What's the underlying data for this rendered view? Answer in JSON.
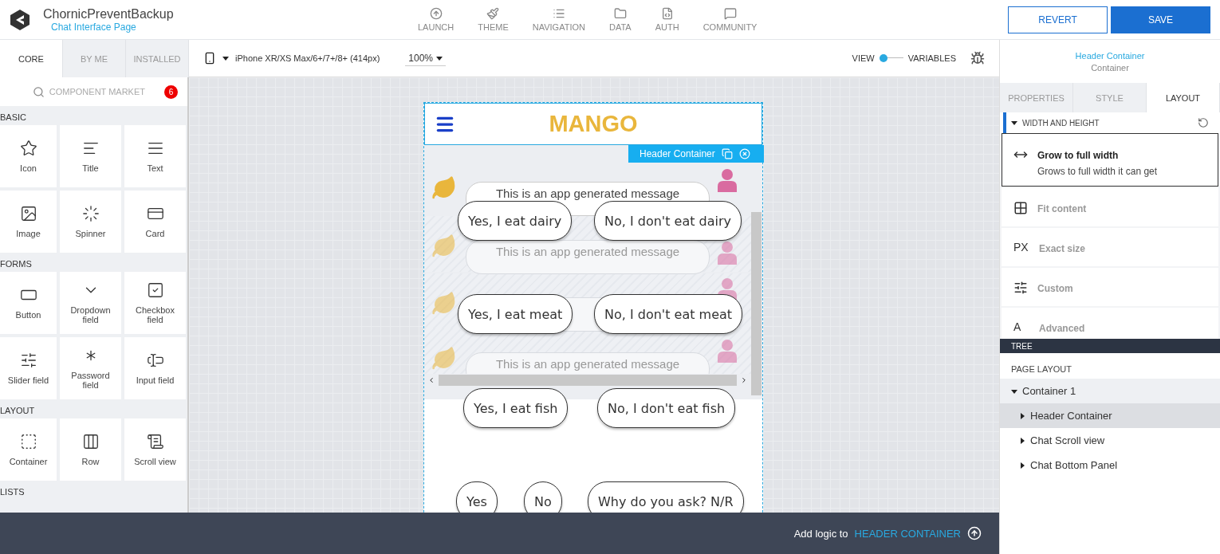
{
  "app": {
    "title": "ChornicPreventBackup",
    "page": "Chat Interface Page"
  },
  "nav": [
    "LAUNCH",
    "THEME",
    "NAVIGATION",
    "DATA",
    "AUTH",
    "COMMUNITY"
  ],
  "actions": [
    {
      "label": "REVERT",
      "kind": "outline"
    },
    {
      "label": "SAVE",
      "kind": "primary"
    }
  ],
  "component_tabs": [
    {
      "label": "CORE",
      "selected": true
    },
    {
      "label": "BY ME",
      "selected": false
    },
    {
      "label": "INSTALLED",
      "selected": false
    }
  ],
  "market": {
    "label": "COMPONENT MARKET",
    "badge": "6"
  },
  "component_groups": [
    {
      "title": "BASIC",
      "items": [
        "Icon",
        "Title",
        "Text",
        "Image",
        "Spinner",
        "Card"
      ]
    },
    {
      "title": "FORMS",
      "items": [
        "Button",
        "Dropdown field",
        "Checkbox field",
        "Slider field",
        "Password field",
        "Input field"
      ]
    },
    {
      "title": "LAYOUT",
      "items": [
        "Container",
        "Row",
        "Scroll view"
      ]
    },
    {
      "title": "LISTS"
    }
  ],
  "device": {
    "label": "iPhone XR/XS Max/6+/7+/8+ (414px)",
    "zoom": "100%"
  },
  "view_toggle": {
    "left": "VIEW",
    "right": "VARIABLES",
    "on": false
  },
  "preview": {
    "title": "MANGO",
    "selection_label": "Header Container",
    "messages": [
      "This is an app generated message",
      "This is an app generated message",
      "This is an app generated message"
    ],
    "choice_rows": [
      [
        "Yes, I eat dairy",
        "No, I don't eat dairy"
      ],
      [
        "Yes, I eat meat",
        "No, I don't eat meat"
      ],
      [
        "Yes, I eat fish",
        "No, I don't eat fish"
      ],
      [
        "Yes",
        "No",
        "Why do you ask? N/R"
      ]
    ]
  },
  "logic_bar": {
    "label": "Add logic to",
    "target": "HEADER CONTAINER"
  },
  "inspector": {
    "name": "Header Container",
    "type": "Container",
    "tabs": [
      {
        "label": "PROPERTIES",
        "selected": false
      },
      {
        "label": "STYLE",
        "selected": false
      },
      {
        "label": "LAYOUT",
        "selected": true
      }
    ],
    "section": {
      "title": "WIDTH AND HEIGHT",
      "expanded": true
    },
    "options": [
      {
        "label": "Grow to full width",
        "description": "Grows to full width it can get",
        "selected": true
      },
      {
        "label": "Fit content",
        "selected": false
      },
      {
        "label": "Exact size",
        "icon_text": "PX",
        "selected": false
      },
      {
        "label": "Custom",
        "selected": false
      },
      {
        "label": "Advanced",
        "icon_text": "A",
        "selected": false
      }
    ]
  },
  "tree": {
    "title": "TREE",
    "heading": "PAGE LAYOUT",
    "items": [
      {
        "label": "Container 1",
        "expanded": true,
        "selected": false,
        "children": [
          {
            "label": "Header Container",
            "expanded": false,
            "selected": true
          },
          {
            "label": "Chat Scroll view",
            "expanded": false,
            "selected": false
          },
          {
            "label": "Chat Bottom Panel",
            "expanded": false,
            "selected": false
          }
        ]
      }
    ]
  }
}
